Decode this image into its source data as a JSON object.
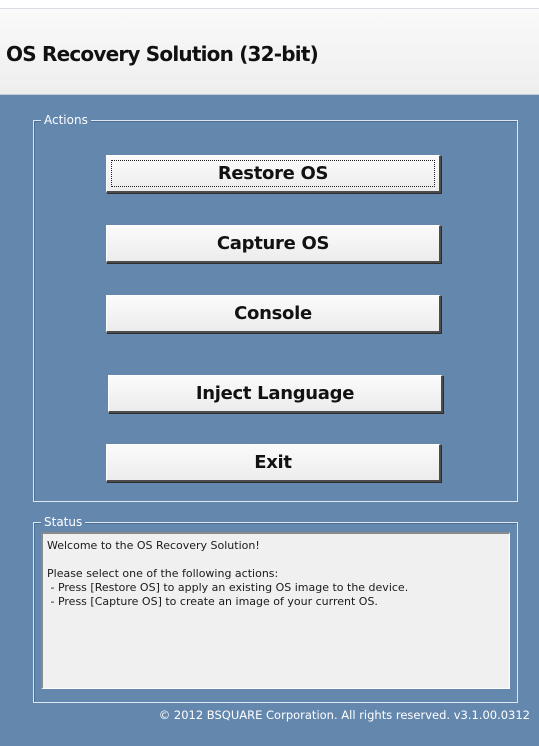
{
  "window": {
    "title": "OS Recovery Solution (32-bit)"
  },
  "actions": {
    "legend": "Actions",
    "buttons": [
      {
        "label": "Restore OS",
        "focused": true
      },
      {
        "label": "Capture OS",
        "focused": false
      },
      {
        "label": "Console",
        "focused": false
      },
      {
        "label": "Inject Language",
        "focused": false
      },
      {
        "label": "Exit",
        "focused": false
      }
    ]
  },
  "status": {
    "legend": "Status",
    "welcome": "Welcome to the OS Recovery Solution!",
    "lines": [
      "Please select one of the following actions:",
      " - Press [Restore OS] to apply an existing OS image to the device.",
      " - Press [Capture OS] to create an image of your current OS."
    ]
  },
  "footer": {
    "copyright": "© 2012 BSQUARE Corporation. All rights reserved. v3.1.00.0312"
  },
  "colors": {
    "background": "#6487ae",
    "title_panel": "#f2f2f2",
    "button_face": "#f3f3f3",
    "status_box": "#f0f0f0"
  }
}
